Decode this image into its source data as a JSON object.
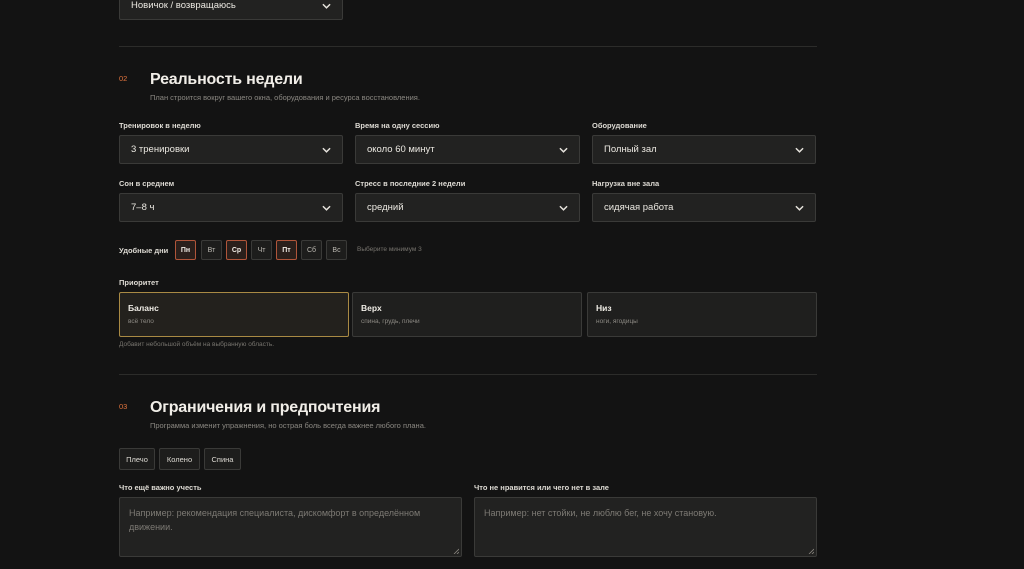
{
  "top_select": {
    "value": "Новичок / возвращаюсь"
  },
  "section2": {
    "number": "02",
    "title": "Реальность недели",
    "subtitle": "План строится вокруг вашего окна, оборудования и ресурса восстановления.",
    "fields": [
      {
        "label": "Тренировок в неделю",
        "value": "3 тренировки"
      },
      {
        "label": "Время на одну сессию",
        "value": "около 60 минут"
      },
      {
        "label": "Оборудование",
        "value": "Полный зал"
      },
      {
        "label": "Сон в среднем",
        "value": "7–8 ч"
      },
      {
        "label": "Стресс в последние 2 недели",
        "value": "средний"
      },
      {
        "label": "Нагрузка вне зала",
        "value": "сидячая работа"
      }
    ],
    "days_label": "Удобные дни",
    "days": [
      {
        "label": "Пн",
        "selected": true
      },
      {
        "label": "Вт",
        "selected": false
      },
      {
        "label": "Ср",
        "selected": true
      },
      {
        "label": "Чт",
        "selected": false
      },
      {
        "label": "Пт",
        "selected": true
      },
      {
        "label": "Сб",
        "selected": false
      },
      {
        "label": "Вс",
        "selected": false
      }
    ],
    "days_hint": "Выберите минимум 3",
    "priority_label": "Приоритет",
    "priorities": [
      {
        "title": "Баланс",
        "sub": "всё тело",
        "selected": true
      },
      {
        "title": "Верх",
        "sub": "спина, грудь, плечи",
        "selected": false
      },
      {
        "title": "Низ",
        "sub": "ноги, ягодицы",
        "selected": false
      }
    ],
    "priority_hint": "Добавит небольшой объём на выбранную область."
  },
  "section3": {
    "number": "03",
    "title": "Ограничения и предпочтения",
    "subtitle": "Программа изменит упражнения, но острая боль всегда важнее любого плана.",
    "chips": [
      "Плечо",
      "Колено",
      "Спина"
    ],
    "notes": [
      {
        "label": "Что ещё важно учесть",
        "placeholder": "Например: рекомендация специалиста, дискомфорт в определённом движении."
      },
      {
        "label": "Что не нравится или чего нет в зале",
        "placeholder": "Например: нет стойки, не люблю бег, не хочу становую."
      }
    ]
  },
  "colors": {
    "accent": "#e0733d",
    "selected_border": "#a98a44",
    "background": "#131313"
  }
}
